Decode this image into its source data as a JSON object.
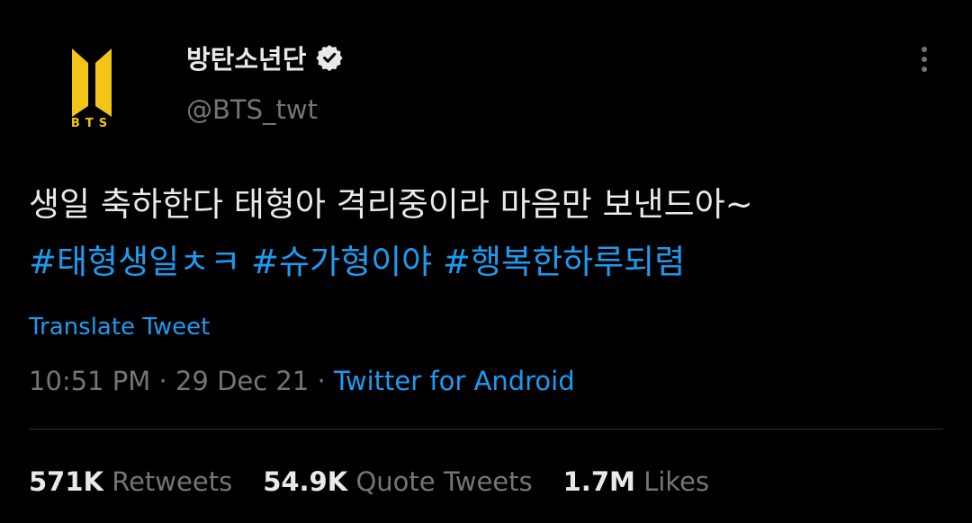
{
  "author": {
    "display_name": "방탄소년단",
    "handle": "@BTS_twt",
    "logo_text": "BTS",
    "verified": true
  },
  "tweet": {
    "text": "생일 축하한다 태형아 격리중이라 마음만 보낸드아~",
    "hashtags": [
      "#태형생일ㅊㅋ",
      "#슈가형이야",
      "#행복한하루되렴"
    ]
  },
  "translate_label": "Translate Tweet",
  "meta": {
    "time": "10:51 PM",
    "separator": " · ",
    "date": "29 Dec 21",
    "source": "Twitter for Android"
  },
  "stats": {
    "retweets": {
      "value": "571K",
      "label": "Retweets"
    },
    "quotes": {
      "value": "54.9K",
      "label": "Quote Tweets"
    },
    "likes": {
      "value": "1.7M",
      "label": "Likes"
    }
  },
  "colors": {
    "background": "#000000",
    "text": "#e7e9ea",
    "secondary": "#71767b",
    "accent": "#1d9bf0",
    "logo": "#f3c519"
  }
}
